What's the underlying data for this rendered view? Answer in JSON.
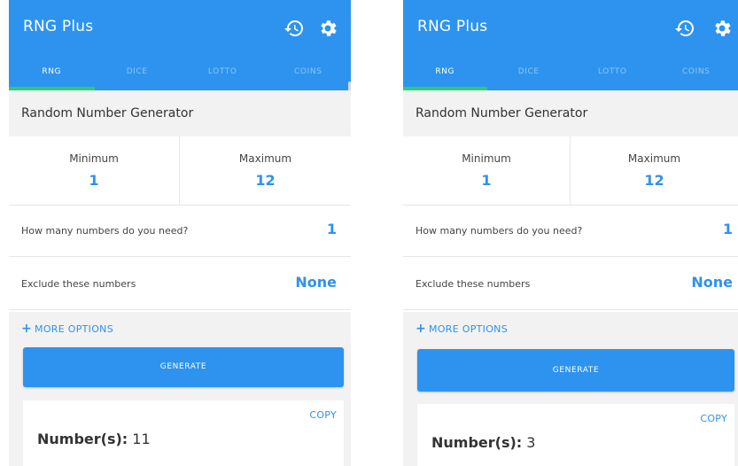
{
  "screens": [
    {
      "app_title": "RNG Plus",
      "tabs": [
        "RNG",
        "DICE",
        "LOTTO",
        "COINS"
      ],
      "section_title": "Random Number Generator",
      "minimum_label": "Minimum",
      "minimum_value": "1",
      "maximum_label": "Maximum",
      "maximum_value": "12",
      "count_label": "How many numbers do you need?",
      "count_value": "1",
      "exclude_label": "Exclude these numbers",
      "exclude_value": "None",
      "more_options": "MORE OPTIONS",
      "generate_label": "GENERATE",
      "copy_label": "COPY",
      "result_label": "Number(s):",
      "result_value": "11"
    },
    {
      "app_title": "RNG Plus",
      "tabs": [
        "RNG",
        "DICE",
        "LOTTO",
        "COINS"
      ],
      "section_title": "Random Number Generator",
      "minimum_label": "Minimum",
      "minimum_value": "1",
      "maximum_label": "Maximum",
      "maximum_value": "12",
      "count_label": "How many numbers do you need?",
      "count_value": "1",
      "exclude_label": "Exclude these numbers",
      "exclude_value": "None",
      "more_options": "MORE OPTIONS",
      "generate_label": "GENERATE",
      "copy_label": "COPY",
      "result_label": "Number(s):",
      "result_value": "3"
    }
  ],
  "colors": {
    "primary": "#2d93ee",
    "tab_indicator": "#2ecc71",
    "background_gray": "#f2f2f2"
  },
  "active_tab": "RNG",
  "icons": [
    "history-icon",
    "gear-icon",
    "plus-icon"
  ]
}
